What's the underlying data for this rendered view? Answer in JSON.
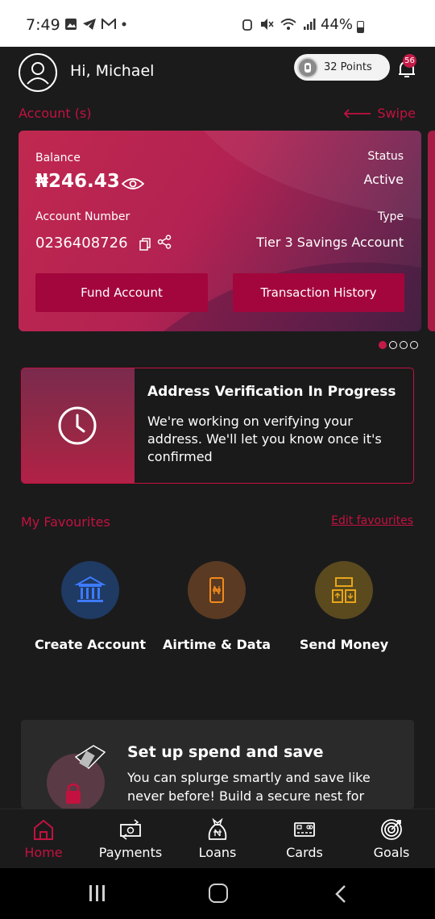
{
  "status_bar": {
    "time": "7:49",
    "battery": "44%"
  },
  "header": {
    "greeting": "Hi, Michael",
    "points": "32 Points",
    "notification_count": "56"
  },
  "accounts": {
    "title": "Account (s)",
    "swipe_label": "Swipe"
  },
  "account_card": {
    "balance_label": "Balance",
    "balance": "₦246.43",
    "status_label": "Status",
    "status": "Active",
    "account_number_label": "Account Number",
    "account_number": "0236408726",
    "type_label": "Type",
    "type": "Tier 3 Savings Account",
    "fund_button": "Fund Account",
    "history_button": "Transaction History"
  },
  "carousel": {
    "total": 4,
    "active": 0
  },
  "verification": {
    "title": "Address Verification In Progress",
    "body": "We're working on verifying your address. We'll let you know once it's confirmed"
  },
  "favourites": {
    "title": "My Favourites",
    "edit_label": "Edit favourites",
    "items": [
      {
        "label": "Create Account",
        "icon": "bank-icon",
        "color": "#1f3a63"
      },
      {
        "label": "Airtime & Data",
        "icon": "phone-naira-icon",
        "color": "#5a3a22"
      },
      {
        "label": "Send Money",
        "icon": "money-transfer-icon",
        "color": "#5a4a1e"
      }
    ]
  },
  "promo": {
    "title": "Set up spend and save",
    "body": "You can splurge smartly and save like never before! Build a secure nest for"
  },
  "bottom_nav": [
    {
      "label": "Home",
      "icon": "home-icon",
      "active": true
    },
    {
      "label": "Payments",
      "icon": "payments-icon",
      "active": false
    },
    {
      "label": "Loans",
      "icon": "loans-bag-icon",
      "active": false
    },
    {
      "label": "Cards",
      "icon": "card-icon",
      "active": false
    },
    {
      "label": "Goals",
      "icon": "target-icon",
      "active": false
    }
  ],
  "colors": {
    "accent": "#c3123f",
    "background": "#1b1b1c",
    "button": "#a3063c"
  }
}
